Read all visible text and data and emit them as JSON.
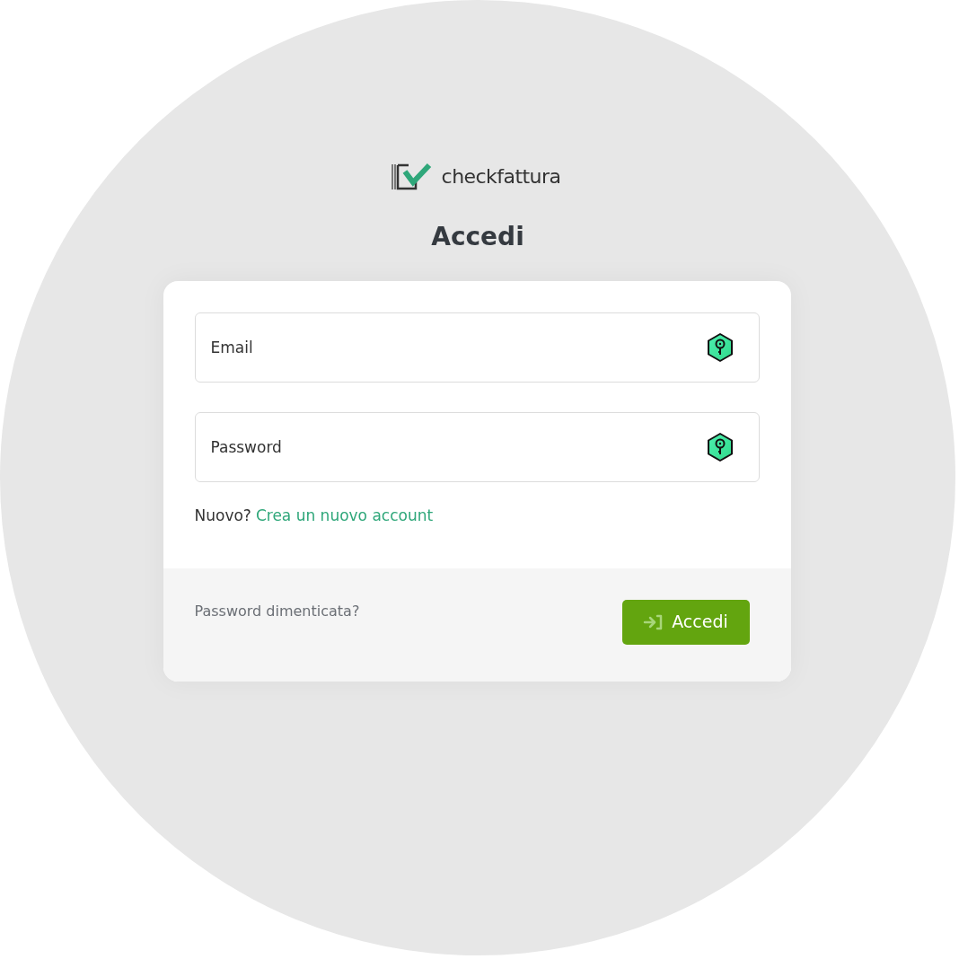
{
  "brand": {
    "name": "checkfattura"
  },
  "title": "Accedi",
  "form": {
    "fields": [
      {
        "placeholder": "Email"
      },
      {
        "placeholder": "Password"
      }
    ],
    "signup_prompt": "Nuovo?",
    "signup_link": "Crea un nuovo account",
    "forgot_link": "Password dimenticata?",
    "submit": "Accedi"
  }
}
